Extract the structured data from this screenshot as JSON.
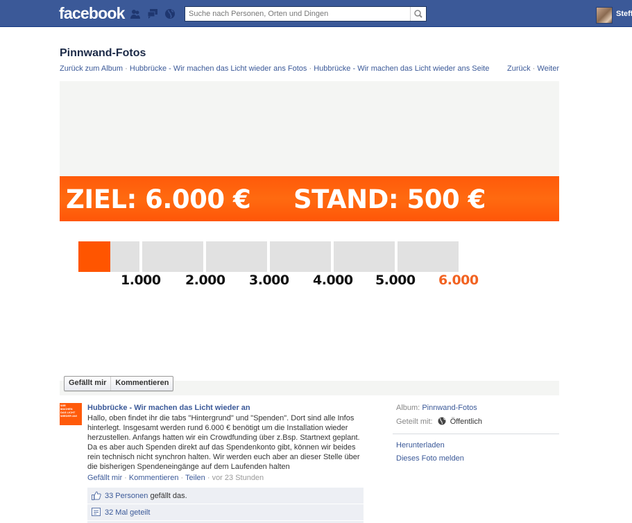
{
  "topbar": {
    "logo": "facebook",
    "jewels": [
      "friend-requests-icon",
      "messages-icon",
      "notifications-globe-icon"
    ],
    "search_placeholder": "Suche nach Personen, Orten und Dingen",
    "search_value": "",
    "user_name": "Steff"
  },
  "header": {
    "title": "Pinnwand-Fotos",
    "breadcrumbs": [
      "Zurück zum Album",
      "Hubbrücke - Wir machen das Licht wieder ans Fotos",
      "Hubbrücke - Wir machen das Licht wieder ans Seite"
    ],
    "separator": " · ",
    "nav": {
      "prev": "Zurück",
      "next": "Weiter"
    }
  },
  "photo": {
    "banner_goal": "ZIEL: 6.000 €",
    "banner_status": "STAND: 500 €",
    "progress": {
      "current": 500,
      "goal": 6000,
      "fraction": 0.0833,
      "ticks": [
        "1.000",
        "2.000",
        "3.000",
        "4.000",
        "5.000",
        "6.000"
      ]
    },
    "colors": {
      "accent": "#ff5500",
      "goal_tick": "#f26322",
      "empty": "#e1e1e1"
    },
    "like_button": "Gefällt mir",
    "comment_button": "Kommentieren"
  },
  "post": {
    "author": "Hubbrücke - Wir machen das Licht wieder an",
    "thumb_text": [
      "WIR",
      "MACHEN",
      "DAS LICHT",
      "WIEDER AN!"
    ],
    "text": "Hallo, oben findet ihr die tabs \"Hintergrund\" und \"Spenden\". Dort sind alle Infos hinterlegt. Insgesamt werden rund 6.000 € benötigt um die Installation wieder herzustellen. Anfangs hatten wir ein Crowdfunding über z.Bsp. Startnext geplant. Da es aber auch Spenden direkt auf das Spendenkonto gibt, können wir beides rein technisch nicht synchron halten. Wir werden euch aber an dieser Stelle über die bisherigen Spendeneingänge auf dem Laufenden halten",
    "actions": {
      "like": "Gefällt mir",
      "comment": "Kommentieren",
      "share": "Teilen",
      "time": "vor 23 Stunden"
    },
    "likes_link": "33 Personen",
    "likes_suffix": " gefällt das.",
    "shares": "32 Mal geteilt"
  },
  "side": {
    "album_label": "Album:",
    "album_value": "Pinnwand-Fotos",
    "shared_label": "Geteilt mit:",
    "shared_value": "Öffentlich",
    "download": "Herunterladen",
    "report": "Dieses Foto melden"
  }
}
